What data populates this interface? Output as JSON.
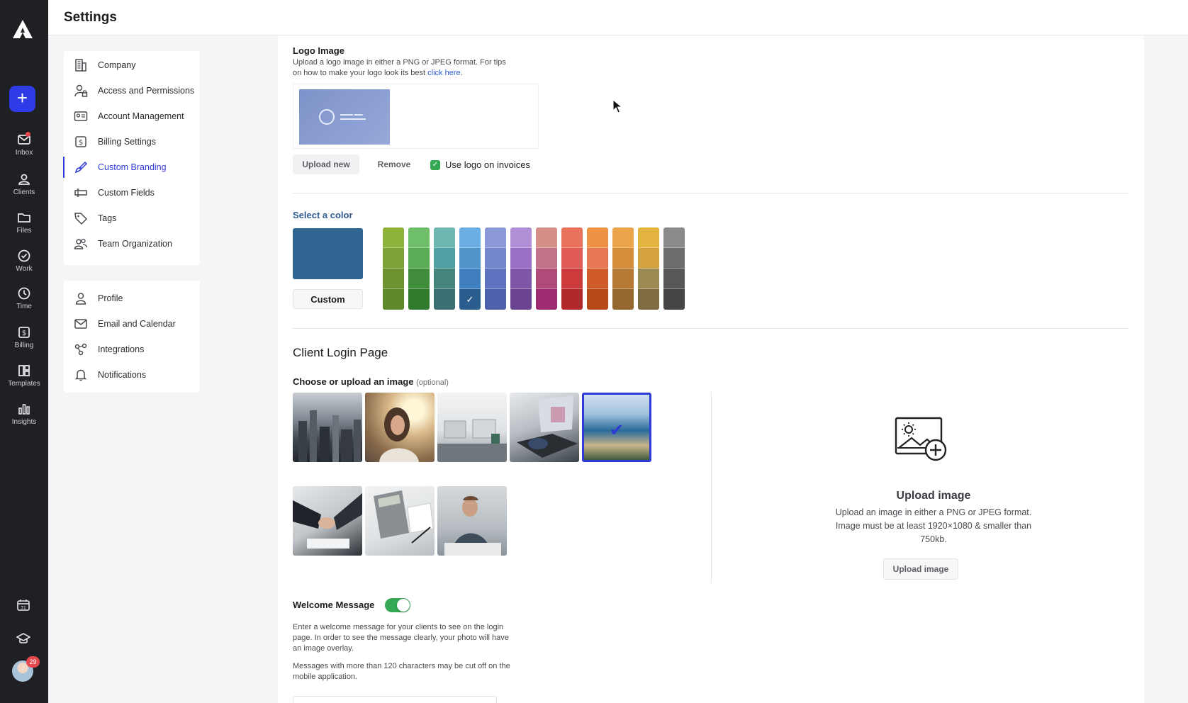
{
  "app": {
    "header_title": "Settings"
  },
  "rail": {
    "items": [
      {
        "label": "Inbox",
        "icon": "inbox-icon",
        "notification_dot": true
      },
      {
        "label": "Clients",
        "icon": "clients-icon"
      },
      {
        "label": "Files",
        "icon": "folder-icon"
      },
      {
        "label": "Work",
        "icon": "check-circle-icon"
      },
      {
        "label": "Time",
        "icon": "clock-icon"
      },
      {
        "label": "Billing",
        "icon": "billing-icon"
      },
      {
        "label": "Templates",
        "icon": "templates-icon"
      },
      {
        "label": "Insights",
        "icon": "bar-chart-icon"
      }
    ],
    "add_label": "+",
    "avatar_badge": "29"
  },
  "settings_nav": {
    "group1": [
      {
        "label": "Company",
        "icon": "building-icon"
      },
      {
        "label": "Access and Permissions",
        "icon": "user-lock-icon"
      },
      {
        "label": "Account Management",
        "icon": "id-card-icon"
      },
      {
        "label": "Billing Settings",
        "icon": "dollar-icon"
      },
      {
        "label": "Custom Branding",
        "icon": "brush-icon",
        "active": true
      },
      {
        "label": "Custom Fields",
        "icon": "fields-icon"
      },
      {
        "label": "Tags",
        "icon": "tag-icon"
      },
      {
        "label": "Team Organization",
        "icon": "team-icon"
      }
    ],
    "group2": [
      {
        "label": "Profile",
        "icon": "person-icon"
      },
      {
        "label": "Email and Calendar",
        "icon": "envelope-icon"
      },
      {
        "label": "Integrations",
        "icon": "integrations-icon"
      },
      {
        "label": "Notifications",
        "icon": "bell-icon"
      }
    ]
  },
  "logo_section": {
    "title": "Logo Image",
    "desc_line1": "Upload a logo image in either a PNG or JPEG format. For tips",
    "desc_line2": "on how to make your logo look its best ",
    "link": "click here",
    "desc_end": ".",
    "upload_new": "Upload new",
    "remove": "Remove",
    "use_logo_label": "Use logo on invoices",
    "use_logo_checked": true
  },
  "color_section": {
    "title": "Select a color",
    "selected_color": "#2f6590",
    "custom_label": "Custom",
    "selected_swatch": "#2b5e8f",
    "palette": [
      [
        "#8fb23d",
        "#7ea236",
        "#6c932f",
        "#5e8a2a"
      ],
      [
        "#6fbf6a",
        "#5aac55",
        "#3f8d3b",
        "#2f7a2c"
      ],
      [
        "#6fb6b0",
        "#4fa0a3",
        "#46857d",
        "#3c6f74"
      ],
      [
        "#6aaee3",
        "#4f95c9",
        "#3f7fbf",
        "#2b5e8f"
      ],
      [
        "#8a98d8",
        "#7486cd",
        "#5f72bf",
        "#4d62ab"
      ],
      [
        "#b08fd6",
        "#9a6fc8",
        "#7e56a8",
        "#6a4490"
      ],
      [
        "#d49088",
        "#c3728a",
        "#b04a78",
        "#9c2c6f"
      ],
      [
        "#e8725b",
        "#e05b56",
        "#cc3a3c",
        "#b02a2c"
      ],
      [
        "#ec9348",
        "#e77853",
        "#cf5b2a",
        "#b84a1a"
      ],
      [
        "#eca44a",
        "#d58d3c",
        "#b77a35",
        "#93672e"
      ],
      [
        "#e4b441",
        "#d4a33d",
        "#9c8a53",
        "#7f6c43"
      ],
      [
        "#8a8a8a",
        "#6c6c6c",
        "#57575a",
        "#444644"
      ]
    ]
  },
  "login_section": {
    "title": "Client Login Page",
    "choose_title": "Choose or upload an image ",
    "choose_optional": "(optional)",
    "upload_title": "Upload image",
    "upload_desc1": "Upload an image in either a PNG or JPEG format.",
    "upload_desc2": "Image must be at least 1920×1080 & smaller than",
    "upload_desc3": "750kb.",
    "upload_btn": "Upload image"
  },
  "welcome_section": {
    "title": "Welcome Message",
    "toggle_on": true,
    "desc1": "Enter a welcome message for your clients to see on the login",
    "desc2": "page. In order to see the message clearly, your photo will have",
    "desc3": "an image overlay.",
    "desc4": "Messages with more than 120 characters may be cut off on the",
    "desc5": "mobile application."
  }
}
